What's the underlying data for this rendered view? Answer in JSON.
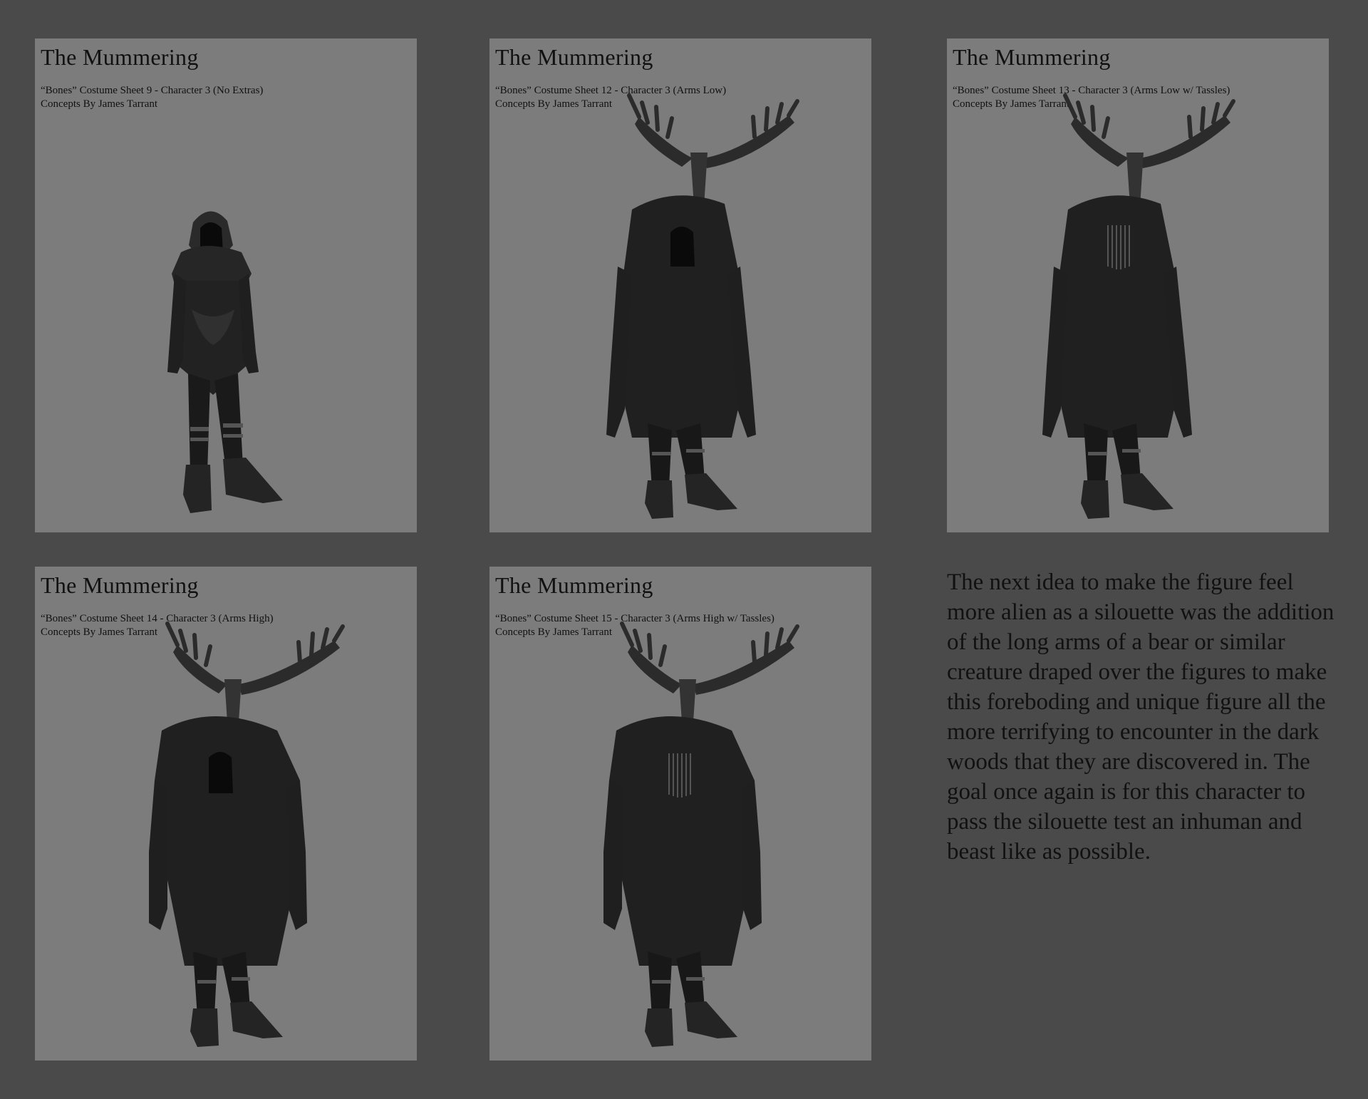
{
  "sheets": [
    {
      "title": "The Mummering",
      "subtitle": "“Bones” Costume Sheet 9 - Character 3 (No Extras)",
      "credit": "Concepts By James Tarrant",
      "variant": "hood-only"
    },
    {
      "title": "The Mummering",
      "subtitle": "“Bones” Costume Sheet 12 - Character 3 (Arms Low)",
      "credit": "Concepts By James Tarrant",
      "variant": "antlers-arms-low"
    },
    {
      "title": "The Mummering",
      "subtitle": "“Bones” Costume Sheet 13 - Character 3 (Arms Low w/ Tassles)",
      "credit": "Concepts By James Tarrant",
      "variant": "antlers-arms-low-tassles"
    },
    {
      "title": "The Mummering",
      "subtitle": "“Bones” Costume Sheet 14 - Character 3 (Arms High)",
      "credit": "Concepts By James Tarrant",
      "variant": "antlers-arms-high"
    },
    {
      "title": "The Mummering",
      "subtitle": "“Bones” Costume Sheet 15 - Character 3 (Arms High w/ Tassles)",
      "credit": "Concepts By James Tarrant",
      "variant": "antlers-arms-high-tassles"
    }
  ],
  "description": "The next idea to make the figure feel more alien as a silouette was the addition of the long arms of a bear or similar creature draped over the figures to make this foreboding and unique figure all the more terrifying to encounter in the dark woods that they are discovered in. The goal once again is for this character to pass the silouette test an inhuman and beast like as possible.",
  "colors": {
    "page_background": "#4a4a4a",
    "sheet_background": "#7c7c7c",
    "figure_dark": "#1c1c1c"
  }
}
